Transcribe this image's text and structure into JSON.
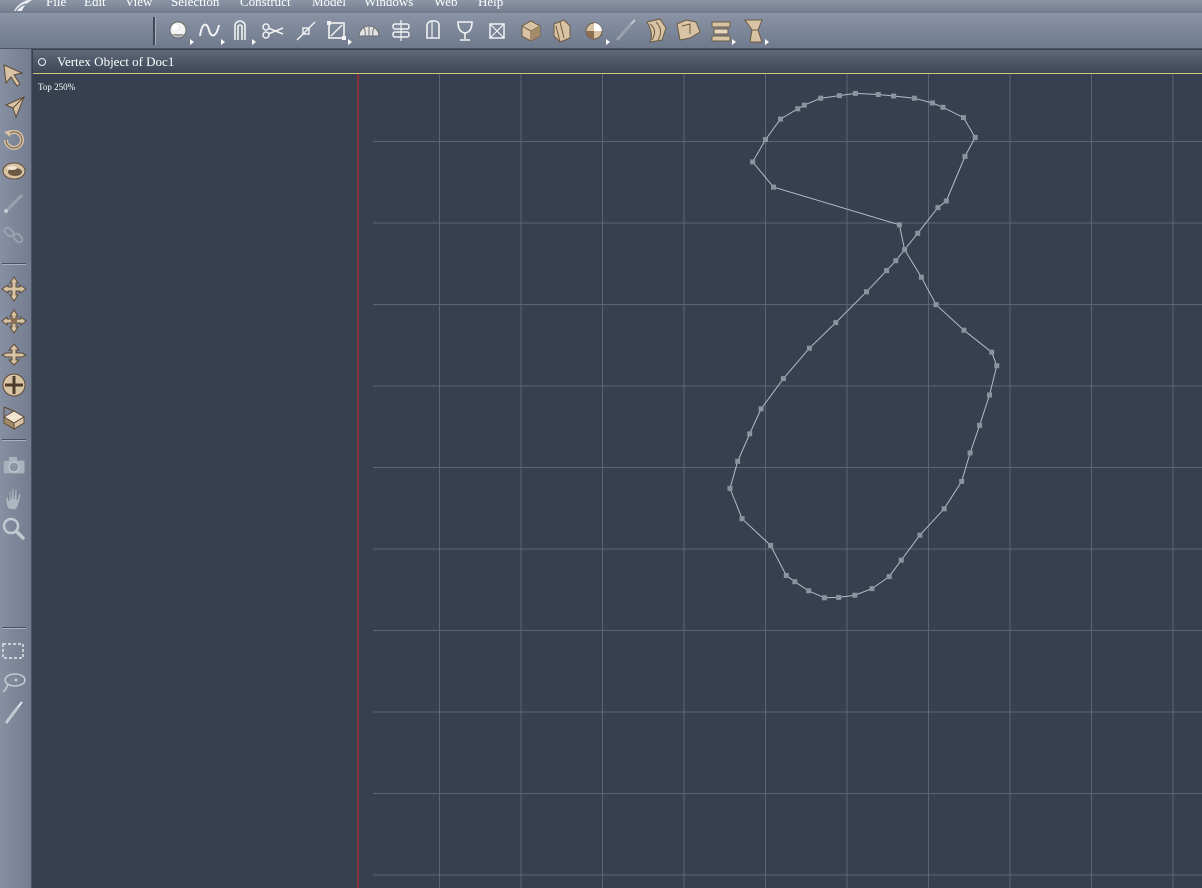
{
  "menu": [
    {
      "label": "File",
      "name": "menu-file"
    },
    {
      "label": "Edit",
      "name": "menu-edit"
    },
    {
      "label": "View",
      "name": "menu-view"
    },
    {
      "label": "Selection",
      "name": "menu-selection"
    },
    {
      "label": "Construct",
      "name": "menu-construct"
    },
    {
      "label": "Model",
      "name": "menu-model"
    },
    {
      "label": "Windows",
      "name": "menu-windows"
    },
    {
      "label": "Web",
      "name": "menu-web"
    },
    {
      "label": "Help",
      "name": "menu-help"
    }
  ],
  "toolbar": {
    "tools": [
      {
        "icon": "sphere-icon",
        "more": true
      },
      {
        "icon": "spline-icon",
        "more": true
      },
      {
        "icon": "lathe-icon",
        "more": true
      },
      {
        "icon": "scissors-icon",
        "more": false
      },
      {
        "icon": "add-point-icon",
        "more": false
      },
      {
        "icon": "bounding-box-icon",
        "more": true
      },
      {
        "icon": "dome-icon",
        "more": false
      },
      {
        "icon": "sweep-icon",
        "more": false
      },
      {
        "icon": "extrude-icon",
        "more": false
      },
      {
        "icon": "goblet-icon",
        "more": false
      },
      {
        "icon": "crossed-box-icon",
        "more": false
      },
      {
        "icon": "cube-icon",
        "more": false
      },
      {
        "icon": "wrap-icon",
        "more": false
      },
      {
        "icon": "material-ball-icon",
        "more": true
      },
      {
        "icon": "brush-icon",
        "more": false
      },
      {
        "icon": "deform-twist-icon",
        "more": false
      },
      {
        "icon": "deform-bend-icon",
        "more": false
      },
      {
        "icon": "deform-align-icon",
        "more": true
      },
      {
        "icon": "deform-taper-icon",
        "more": true
      }
    ]
  },
  "palette": {
    "tools": [
      {
        "icon": "select-arrow-icon"
      },
      {
        "icon": "direct-select-icon"
      },
      {
        "icon": "rotate-icon"
      },
      {
        "icon": "virtual-trackball-icon"
      },
      {
        "icon": "link-icon"
      },
      {
        "icon": "unlink-icon"
      },
      {
        "icon": "move-icon"
      },
      {
        "icon": "move-planar-icon"
      },
      {
        "icon": "move-vertical-icon"
      },
      {
        "icon": "scale-icon"
      },
      {
        "icon": "working-box-icon"
      },
      {
        "icon": "camera-icon"
      },
      {
        "icon": "pan-hand-icon"
      },
      {
        "icon": "zoom-icon"
      },
      {
        "icon": "marquee-select-icon"
      },
      {
        "icon": "lasso-select-icon"
      },
      {
        "icon": "paint-select-icon"
      }
    ]
  },
  "document": {
    "title": "Vertex Object of Doc1",
    "view_label": "Top 250%",
    "colors": {
      "background": "#36404f",
      "grid": "#5a6475",
      "origin_line": "#c0282e",
      "curve": "#b6bcc6",
      "vertex": "#8c939e"
    }
  },
  "curve": {
    "closed": true,
    "vertices_top_view": [
      [
        14.6,
        -64.8
      ],
      [
        16.0,
        -58.0
      ],
      [
        20.6,
        -50.5
      ],
      [
        24.6,
        -43.0
      ],
      [
        32.2,
        -36.0
      ],
      [
        39.8,
        -30.0
      ],
      [
        41.2,
        -26.3
      ],
      [
        39.2,
        -18.3
      ],
      [
        36.5,
        -10.0
      ],
      [
        33.9,
        -2.5
      ],
      [
        31.6,
        5.3
      ],
      [
        26.8,
        12.8
      ],
      [
        20.2,
        20.0
      ],
      [
        15.1,
        26.8
      ],
      [
        11.8,
        31.3
      ],
      [
        7.1,
        34.6
      ],
      [
        2.4,
        36.4
      ],
      [
        -2.0,
        37.0
      ],
      [
        -5.9,
        37.1
      ],
      [
        -10.2,
        35.2
      ],
      [
        -14.0,
        32.7
      ],
      [
        -16.3,
        31.0
      ],
      [
        -20.6,
        22.8
      ],
      [
        -28.4,
        15.5
      ],
      [
        -31.7,
        7.2
      ],
      [
        -29.6,
        -0.2
      ],
      [
        -26.3,
        -7.7
      ],
      [
        -23.2,
        -14.5
      ],
      [
        -17.1,
        -22.8
      ],
      [
        -10.0,
        -31.1
      ],
      [
        -2.8,
        -38.1
      ],
      [
        5.6,
        -46.5
      ],
      [
        11.1,
        -52.3
      ],
      [
        13.6,
        -55.0
      ],
      [
        19.6,
        -62.5
      ],
      [
        25.1,
        -69.5
      ],
      [
        27.4,
        -71.3
      ],
      [
        32.5,
        -83.5
      ],
      [
        35.3,
        -88.7
      ],
      [
        32.1,
        -94.1
      ],
      [
        26.5,
        -96.9
      ],
      [
        23.6,
        -98.1
      ],
      [
        18.7,
        -99.4
      ],
      [
        13.0,
        -100.0
      ],
      [
        8.8,
        -100.4
      ],
      [
        2.6,
        -100.7
      ],
      [
        -1.8,
        -100.1
      ],
      [
        -6.9,
        -99.4
      ],
      [
        -11.4,
        -97.5
      ],
      [
        -13.2,
        -96.5
      ],
      [
        -17.9,
        -93.7
      ],
      [
        -22.0,
        -88.1
      ],
      [
        -25.5,
        -82.0
      ],
      [
        -19.8,
        -75.1
      ]
    ]
  }
}
